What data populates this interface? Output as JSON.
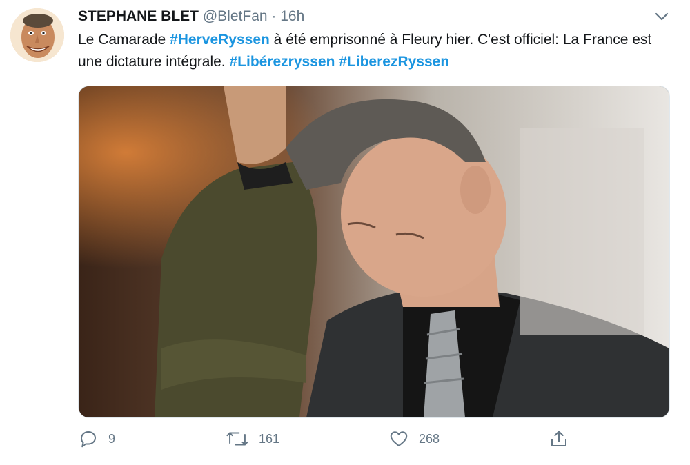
{
  "tweet": {
    "author_name": "STEPHANE BLET",
    "handle": "@BletFan",
    "separator": "·",
    "time": "16h",
    "text_parts": {
      "t1": "Le Camarade ",
      "h1": "#HerveRyssen",
      "t2": " à été emprisonné à Fleury hier. C'est officiel: La France est une dictature intégrale. ",
      "h2": "#Libérezryssen",
      "t3": " ",
      "h3": "#LiberezRyssen"
    },
    "actions": {
      "reply_count": "9",
      "retweet_count": "161",
      "like_count": "268"
    }
  },
  "icons": {
    "reply": "reply-icon",
    "retweet": "retweet-icon",
    "like": "heart-icon",
    "share": "share-icon",
    "menu": "chevron-down-icon"
  },
  "colors": {
    "hashtag": "#1b95e0",
    "secondary_text": "#657786",
    "primary_text": "#14171a"
  }
}
